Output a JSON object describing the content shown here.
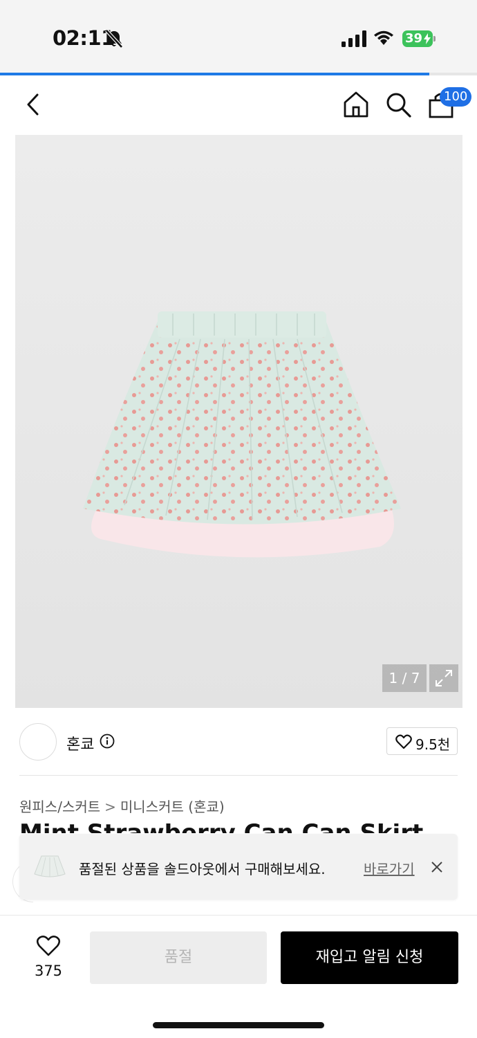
{
  "status_bar": {
    "time": "02:11",
    "battery": "39",
    "icons": [
      "bell-off-icon",
      "signal-icon",
      "wifi-icon",
      "battery-charging-icon"
    ]
  },
  "progress": {
    "fraction": 0.9
  },
  "header": {
    "icons": [
      "back-icon",
      "home-icon",
      "search-icon",
      "cart-icon"
    ],
    "cart_badge": "100",
    "accent_color": "#1f6fe5"
  },
  "gallery": {
    "counter": "1 / 7",
    "expand_icon": "expand-icon"
  },
  "brand": {
    "name": "혼쿄",
    "like_count": "9.5천"
  },
  "breadcrumb": {
    "items": [
      "원피스/스커트",
      "미니스커트 (혼쿄)"
    ],
    "separator": ">"
  },
  "product": {
    "title_partial": "Mint Strawberry Can Can Skirt"
  },
  "toast": {
    "message": "품절된 상품을 솔드아웃에서 구매해보세요.",
    "link": "바로가기",
    "close_icon": "close-icon"
  },
  "actions": {
    "wish_count": "375",
    "soldout_label": "품절",
    "restock_label": "재입고 알림 신청"
  }
}
